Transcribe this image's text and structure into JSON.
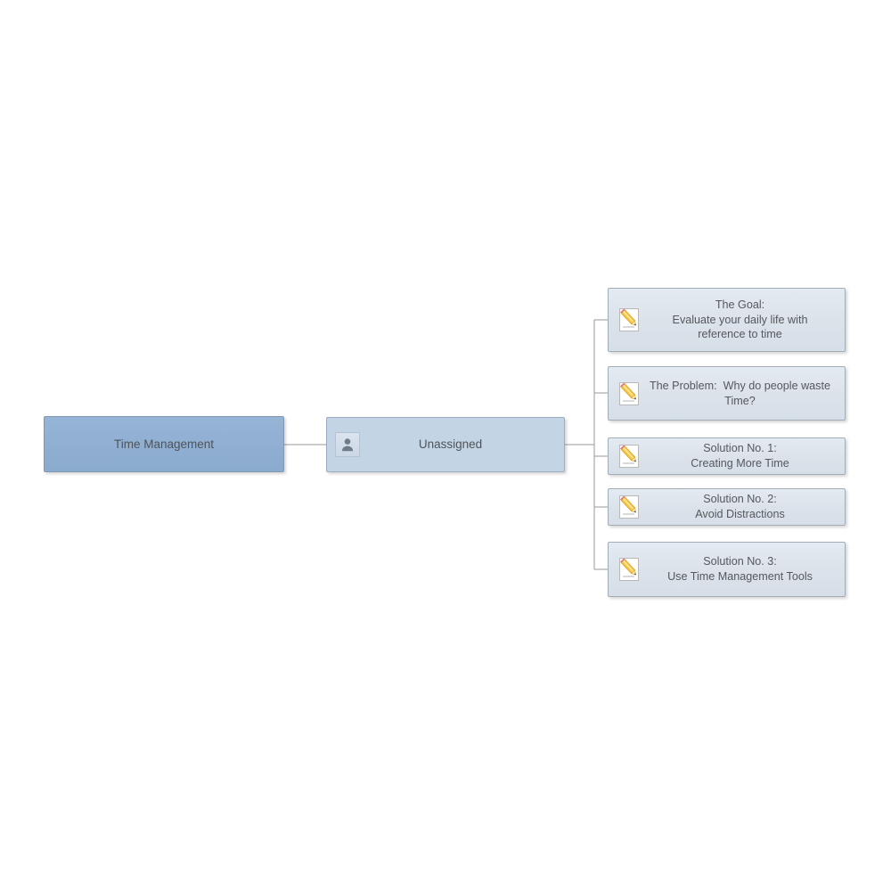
{
  "diagram": {
    "type": "org-chart",
    "title": "Time Management",
    "background_color": "#ffffff",
    "connector_color": "#9a9a9a",
    "root": {
      "label": "Time Management",
      "fill_color": "#8FAFD0",
      "border_color": "#8098b2",
      "text_color": "#4e5459"
    },
    "owner": {
      "label": "Unassigned",
      "icon": "user-icon",
      "fill_color": "#C3D4E4",
      "border_color": "#9aacbe",
      "text_color": "#4e5459"
    },
    "leaf_style": {
      "fill_color": "#DCE3EC",
      "border_color": "#a3adb8",
      "text_color": "#55595e",
      "icon": "note-pencil-icon"
    },
    "leaves": [
      {
        "id": "goal",
        "icon": "note-pencil-icon",
        "label": "The Goal:\nEvaluate your daily life with\nreference to time"
      },
      {
        "id": "problem",
        "icon": "note-pencil-icon",
        "label": "The Problem:  Why do people waste\nTime?"
      },
      {
        "id": "solution-1",
        "icon": "note-pencil-icon",
        "label": "Solution No. 1:\nCreating More Time"
      },
      {
        "id": "solution-2",
        "icon": "note-pencil-icon",
        "label": "Solution No. 2:\nAvoid Distractions"
      },
      {
        "id": "solution-3",
        "icon": "note-pencil-icon",
        "label": "Solution No. 3:\nUse Time Management Tools"
      }
    ]
  }
}
